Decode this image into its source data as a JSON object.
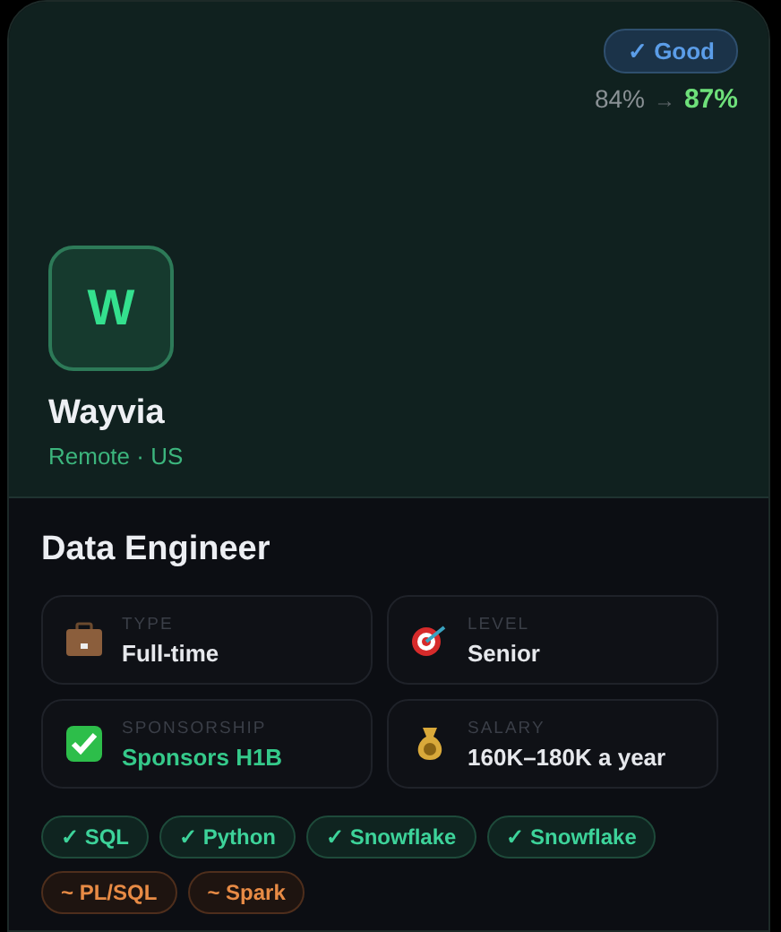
{
  "match": {
    "badge": "✓ Good",
    "previous": "84%",
    "arrow": "→",
    "current": "87%"
  },
  "company": {
    "logo": "W",
    "name": "Wayvia",
    "location": "Remote · US"
  },
  "job": {
    "title": "Data Engineer",
    "details": [
      {
        "kind": "type",
        "label": "TYPE",
        "value": "Full-time",
        "highlight": false
      },
      {
        "kind": "level",
        "label": "LEVEL",
        "value": "Senior",
        "highlight": false
      },
      {
        "kind": "sponsorship",
        "label": "SPONSORSHIP",
        "value": "Sponsors H1B",
        "highlight": true
      },
      {
        "kind": "salary",
        "label": "SALARY",
        "value": "160K–180K a year",
        "highlight": false
      }
    ],
    "skills": [
      {
        "label": "✓ SQL",
        "kind": "match"
      },
      {
        "label": "✓ Python",
        "kind": "match"
      },
      {
        "label": "✓ Snowflake",
        "kind": "match"
      },
      {
        "label": "✓ Snowflake",
        "kind": "match"
      },
      {
        "label": "~ PL/SQL",
        "kind": "partial"
      },
      {
        "label": "~ Spark",
        "kind": "partial"
      }
    ]
  }
}
